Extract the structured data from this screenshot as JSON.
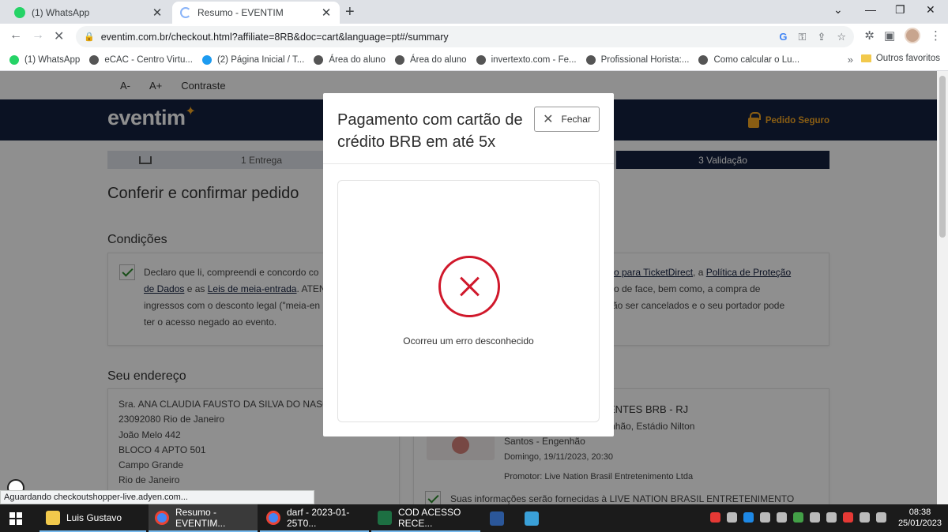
{
  "browser": {
    "tabs": [
      {
        "label": "(1) WhatsApp",
        "icon": "whatsapp-icon",
        "color": "#25d366"
      },
      {
        "label": "Resumo - EVENTIM",
        "icon": "loading-spinner-icon",
        "color": "#8ab4f8"
      }
    ],
    "url": "eventim.com.br/checkout.html?affiliate=8RB&doc=cart&language=pt#/summary",
    "bookmarks": [
      {
        "label": "(1) WhatsApp",
        "color": "#25d366"
      },
      {
        "label": "eCAC - Centro Virtu...",
        "color": "#555555"
      },
      {
        "label": "(2) Página Inicial / T...",
        "color": "#1d9bf0"
      },
      {
        "label": "Área do aluno",
        "color": "#555555"
      },
      {
        "label": "Área do aluno",
        "color": "#555555"
      },
      {
        "label": "invertexto.com - Fe...",
        "color": "#555555"
      },
      {
        "label": "Profissional Horista:...",
        "color": "#555555"
      },
      {
        "label": "Como calcular o Lu...",
        "color": "#555555"
      }
    ],
    "more_bookmarks": "»",
    "other_bookmarks": "Outros favoritos",
    "status_text": "Aguardando checkoutshopper-live.adyen.com..."
  },
  "page": {
    "accessibility": {
      "decrease": "A-",
      "increase": "A+",
      "contrast": "Contraste"
    },
    "logo": "eventim",
    "secure_label": "Pedido Seguro",
    "steps": [
      {
        "label": ""
      },
      {
        "label": "1  Entrega"
      },
      {
        "label": ""
      },
      {
        "label": "3  Validação"
      }
    ],
    "title": "Conferir e confirmar pedido",
    "conditions": {
      "heading": "Condições",
      "text_left_a": "Declaro que li, compreendi e concordo co",
      "text_left_link1": "de Dados",
      "text_left_b": " e as ",
      "text_left_link2": "Leis de meia-entrada",
      "text_left_c": ". ATEN",
      "text_left_d": "ingressos com o desconto legal (\"meia-en",
      "text_left_e": "ter o acesso negado ao evento.",
      "text_right_link1": "so para TicketDirect",
      "text_right_a": ", a ",
      "text_right_link2": "Política de Proteção",
      "text_right_b": "ço de face, bem como, a compra de",
      "text_right_c": "rão ser cancelados e o seu portador pode"
    },
    "address": {
      "heading": "Seu endereço",
      "lines": [
        "Sra. ANA CLAUDIA FAUSTO DA SILVA DO NASCI",
        "23092080 Rio de Janeiro",
        "João Melo 442",
        "BLOCO 4 APTO 501",
        "Campo Grande",
        "Rio de Janeiro"
      ]
    },
    "event": {
      "title": "ENTES BRB - RJ",
      "place_a": "Nilton Santos - Engenhão, Estádio Nilton",
      "place_b": "Santos - Engenhão",
      "date": "Domingo, 19/11/2023, 20:30",
      "promoter": "Promotor: Live Nation Brasil Entretenimento Ltda",
      "consent": "Suas informações serão fornecidas à LIVE NATION BRASIL ENTRETENIMENTO"
    }
  },
  "modal": {
    "title": "Pagamento com cartão de crédito BRB em até 5x",
    "close_label": "Fechar",
    "error_icon": "error-x-icon",
    "error_message": "Ocorreu um erro desconhecido",
    "error_color": "#d0182b"
  },
  "taskbar": {
    "items": [
      {
        "label": "Luis Gustavo",
        "icon": "folder-icon",
        "color": "#f2c94c"
      },
      {
        "label": "Resumo - EVENTIM...",
        "icon": "chrome-icon",
        "color": "#4285f4"
      },
      {
        "label": "darf - 2023-01-25T0...",
        "icon": "chrome-icon",
        "color": "#4285f4"
      },
      {
        "label": "COD ACESSO RECE...",
        "icon": "excel-icon",
        "color": "#1d6f42"
      }
    ],
    "time": "08:38",
    "date": "25/01/2023"
  }
}
